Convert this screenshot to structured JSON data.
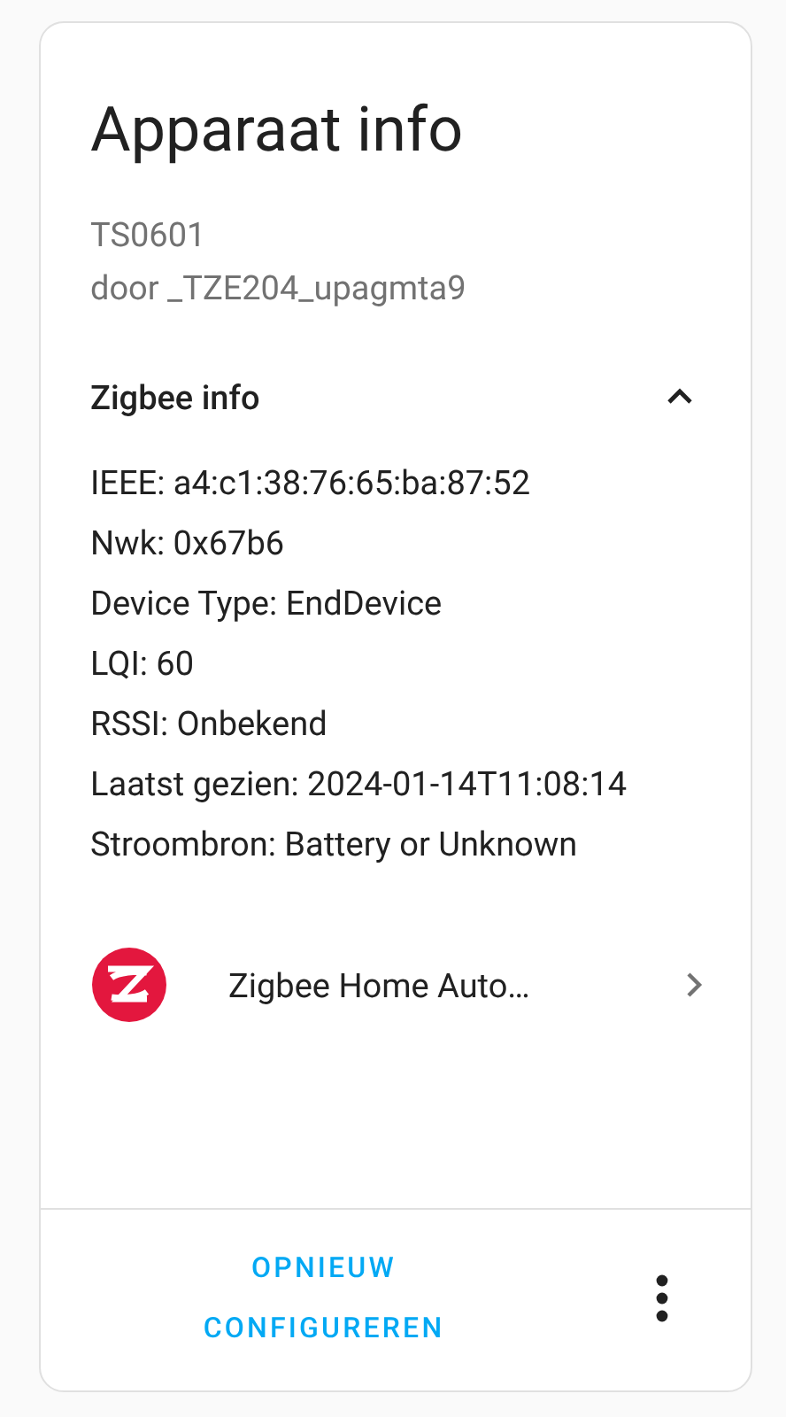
{
  "card": {
    "title": "Apparaat info",
    "model": "TS0601",
    "manufacturer": "door _TZE204_upagmta9"
  },
  "zigbee_section": {
    "title": "Zigbee info",
    "expanded": true,
    "lines": [
      "IEEE: a4:c1:38:76:65:ba:87:52",
      "Nwk: 0x67b6",
      "Device Type: EndDevice",
      "LQI: 60",
      "RSSI: Onbekend",
      "Laatst gezien: 2024-01-14T11:08:14",
      "Stroombron: Battery or Unknown"
    ]
  },
  "integration": {
    "name": "Zigbee Home Auto…"
  },
  "actions": {
    "button": "OPNIEUW CONFIGUREREN"
  }
}
